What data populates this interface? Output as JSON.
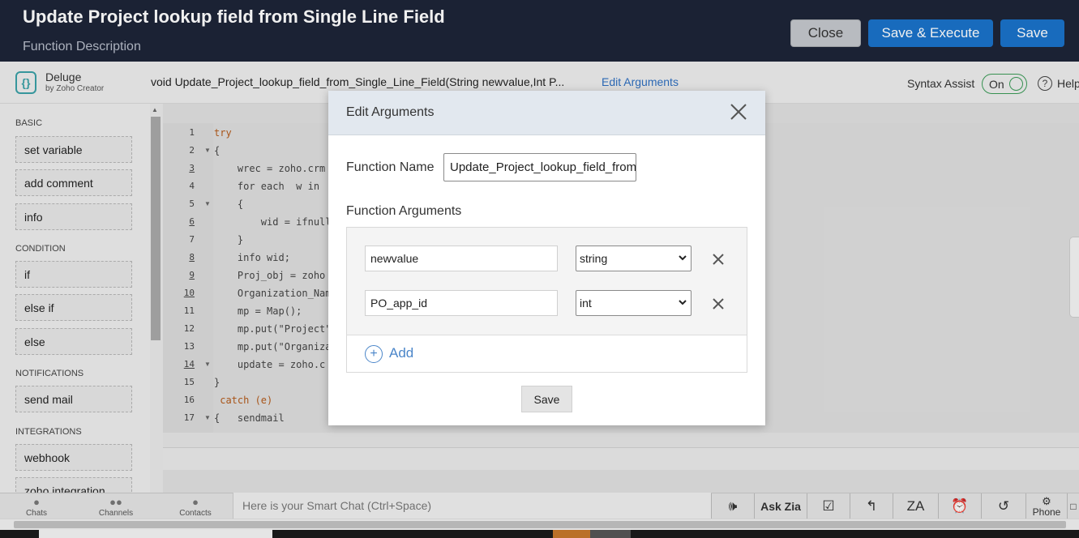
{
  "header": {
    "title": "Update Project lookup field from Single Line Field",
    "subtitle": "Function Description",
    "close_label": "Close",
    "save_execute_label": "Save & Execute",
    "save_label": "Save"
  },
  "toolbar": {
    "logo_name": "Deluge",
    "logo_by": "by Zoho Creator",
    "signature": "void  Update_Project_lookup_field_from_Single_Line_Field(String newvalue,Int P...",
    "edit_arguments_label": "Edit Arguments",
    "syntax_assist_label": "Syntax Assist",
    "syntax_toggle_label": "On",
    "help_label": "Help"
  },
  "sidebar": {
    "sections": [
      {
        "title": "BASIC",
        "items": [
          "set variable",
          "add comment",
          "info"
        ]
      },
      {
        "title": "CONDITION",
        "items": [
          "if",
          "else if",
          "else"
        ]
      },
      {
        "title": "NOTIFICATIONS",
        "items": [
          "send mail"
        ]
      },
      {
        "title": "INTEGRATIONS",
        "items": [
          "webhook",
          "zoho integration"
        ]
      }
    ]
  },
  "editor": {
    "line_numbers": [
      "1",
      "2",
      "3",
      "4",
      "5",
      "6",
      "7",
      "8",
      "9",
      "10",
      "11",
      "12",
      "13",
      "14",
      "15",
      "16",
      "17"
    ],
    "lines": [
      "try",
      "{",
      "    wrec = zoho.crm",
      "    for each  w in",
      "    {",
      "        wid = ifnull",
      "    }",
      "    info wid;",
      "    Proj_obj = zoho",
      "    Organization_Nam",
      "    mp = Map();",
      "    mp.put(\"Project\"",
      "    mp.put(\"Organiza",
      "    update = zoho.c",
      "}",
      " catch (e)",
      "{   sendmail"
    ]
  },
  "modal": {
    "title": "Edit Arguments",
    "function_name_label": "Function Name",
    "function_name_value": "Update_Project_lookup_field_from",
    "function_arguments_label": "Function Arguments",
    "arguments": [
      {
        "name": "newvalue",
        "type": "string"
      },
      {
        "name": "PO_app_id",
        "type": "int"
      }
    ],
    "add_label": "Add",
    "save_label": "Save"
  },
  "chatbar": {
    "nav": [
      "Chats",
      "Channels",
      "Contacts"
    ],
    "placeholder": "Here is your Smart Chat (Ctrl+Space)",
    "ask_zia_label": "Ask Zia",
    "phone_label": "Phone"
  },
  "colors": {
    "header_bg": "#1d2538",
    "primary_button": "#1a72c9",
    "link": "#2e6fc0",
    "toggle_on": "#3b9b57"
  }
}
